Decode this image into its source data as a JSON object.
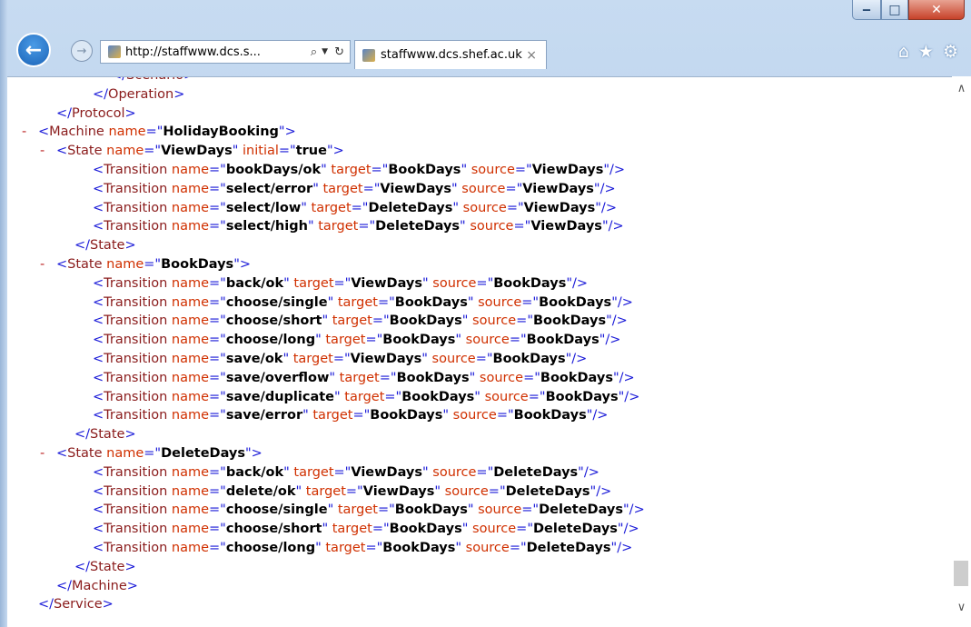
{
  "browser": {
    "address": "http://staffwww.dcs.s...",
    "tab_title": "staffwww.dcs.shef.ac.uk",
    "tab_close": "×",
    "icons": [
      "back-icon",
      "forward-icon",
      "search-icon",
      "refresh-icon",
      "close-icon",
      "home-icon",
      "star-icon",
      "gear-icon"
    ]
  },
  "xml_lines": [
    {
      "indent": 5,
      "minus": false,
      "parts": [
        [
          "blue",
          "</"
        ],
        [
          "tag",
          "Scenario"
        ],
        [
          "blue",
          ">"
        ]
      ]
    },
    {
      "indent": 4,
      "minus": false,
      "parts": [
        [
          "blue",
          "</"
        ],
        [
          "tag",
          "Operation"
        ],
        [
          "blue",
          ">"
        ]
      ]
    },
    {
      "indent": 2,
      "minus": false,
      "parts": [
        [
          "blue",
          "</"
        ],
        [
          "tag",
          "Protocol"
        ],
        [
          "blue",
          ">"
        ]
      ]
    },
    {
      "indent": 1,
      "minus": true,
      "parts": [
        [
          "blue",
          "<"
        ],
        [
          "tag",
          "Machine"
        ],
        [
          "attr",
          " name"
        ],
        [
          "blue",
          "=\""
        ],
        [
          "val",
          "HolidayBooking"
        ],
        [
          "blue",
          "\">"
        ]
      ]
    },
    {
      "indent": 2,
      "minus": true,
      "parts": [
        [
          "blue",
          "<"
        ],
        [
          "tag",
          "State"
        ],
        [
          "attr",
          " name"
        ],
        [
          "blue",
          "=\""
        ],
        [
          "val",
          "ViewDays"
        ],
        [
          "blue",
          "\""
        ],
        [
          "attr",
          " initial"
        ],
        [
          "blue",
          "=\""
        ],
        [
          "val",
          "true"
        ],
        [
          "blue",
          "\">"
        ]
      ]
    },
    {
      "indent": 4,
      "minus": false,
      "parts": [
        [
          "blue",
          "<"
        ],
        [
          "tag",
          "Transition"
        ],
        [
          "attr",
          " name"
        ],
        [
          "blue",
          "=\""
        ],
        [
          "val",
          "bookDays/ok"
        ],
        [
          "blue",
          "\""
        ],
        [
          "attr",
          " target"
        ],
        [
          "blue",
          "=\""
        ],
        [
          "val",
          "BookDays"
        ],
        [
          "blue",
          "\""
        ],
        [
          "attr",
          " source"
        ],
        [
          "blue",
          "=\""
        ],
        [
          "val",
          "ViewDays"
        ],
        [
          "blue",
          "\"/>"
        ]
      ]
    },
    {
      "indent": 4,
      "minus": false,
      "parts": [
        [
          "blue",
          "<"
        ],
        [
          "tag",
          "Transition"
        ],
        [
          "attr",
          " name"
        ],
        [
          "blue",
          "=\""
        ],
        [
          "val",
          "select/error"
        ],
        [
          "blue",
          "\""
        ],
        [
          "attr",
          " target"
        ],
        [
          "blue",
          "=\""
        ],
        [
          "val",
          "ViewDays"
        ],
        [
          "blue",
          "\""
        ],
        [
          "attr",
          " source"
        ],
        [
          "blue",
          "=\""
        ],
        [
          "val",
          "ViewDays"
        ],
        [
          "blue",
          "\"/>"
        ]
      ]
    },
    {
      "indent": 4,
      "minus": false,
      "parts": [
        [
          "blue",
          "<"
        ],
        [
          "tag",
          "Transition"
        ],
        [
          "attr",
          " name"
        ],
        [
          "blue",
          "=\""
        ],
        [
          "val",
          "select/low"
        ],
        [
          "blue",
          "\""
        ],
        [
          "attr",
          " target"
        ],
        [
          "blue",
          "=\""
        ],
        [
          "val",
          "DeleteDays"
        ],
        [
          "blue",
          "\""
        ],
        [
          "attr",
          " source"
        ],
        [
          "blue",
          "=\""
        ],
        [
          "val",
          "ViewDays"
        ],
        [
          "blue",
          "\"/>"
        ]
      ]
    },
    {
      "indent": 4,
      "minus": false,
      "parts": [
        [
          "blue",
          "<"
        ],
        [
          "tag",
          "Transition"
        ],
        [
          "attr",
          " name"
        ],
        [
          "blue",
          "=\""
        ],
        [
          "val",
          "select/high"
        ],
        [
          "blue",
          "\""
        ],
        [
          "attr",
          " target"
        ],
        [
          "blue",
          "=\""
        ],
        [
          "val",
          "DeleteDays"
        ],
        [
          "blue",
          "\""
        ],
        [
          "attr",
          " source"
        ],
        [
          "blue",
          "=\""
        ],
        [
          "val",
          "ViewDays"
        ],
        [
          "blue",
          "\"/>"
        ]
      ]
    },
    {
      "indent": 3,
      "minus": false,
      "parts": [
        [
          "blue",
          "</"
        ],
        [
          "tag",
          "State"
        ],
        [
          "blue",
          ">"
        ]
      ]
    },
    {
      "indent": 2,
      "minus": true,
      "parts": [
        [
          "blue",
          "<"
        ],
        [
          "tag",
          "State"
        ],
        [
          "attr",
          " name"
        ],
        [
          "blue",
          "=\""
        ],
        [
          "val",
          "BookDays"
        ],
        [
          "blue",
          "\">"
        ]
      ]
    },
    {
      "indent": 4,
      "minus": false,
      "parts": [
        [
          "blue",
          "<"
        ],
        [
          "tag",
          "Transition"
        ],
        [
          "attr",
          " name"
        ],
        [
          "blue",
          "=\""
        ],
        [
          "val",
          "back/ok"
        ],
        [
          "blue",
          "\""
        ],
        [
          "attr",
          " target"
        ],
        [
          "blue",
          "=\""
        ],
        [
          "val",
          "ViewDays"
        ],
        [
          "blue",
          "\""
        ],
        [
          "attr",
          " source"
        ],
        [
          "blue",
          "=\""
        ],
        [
          "val",
          "BookDays"
        ],
        [
          "blue",
          "\"/>"
        ]
      ]
    },
    {
      "indent": 4,
      "minus": false,
      "parts": [
        [
          "blue",
          "<"
        ],
        [
          "tag",
          "Transition"
        ],
        [
          "attr",
          " name"
        ],
        [
          "blue",
          "=\""
        ],
        [
          "val",
          "choose/single"
        ],
        [
          "blue",
          "\""
        ],
        [
          "attr",
          " target"
        ],
        [
          "blue",
          "=\""
        ],
        [
          "val",
          "BookDays"
        ],
        [
          "blue",
          "\""
        ],
        [
          "attr",
          " source"
        ],
        [
          "blue",
          "=\""
        ],
        [
          "val",
          "BookDays"
        ],
        [
          "blue",
          "\"/>"
        ]
      ]
    },
    {
      "indent": 4,
      "minus": false,
      "parts": [
        [
          "blue",
          "<"
        ],
        [
          "tag",
          "Transition"
        ],
        [
          "attr",
          " name"
        ],
        [
          "blue",
          "=\""
        ],
        [
          "val",
          "choose/short"
        ],
        [
          "blue",
          "\""
        ],
        [
          "attr",
          " target"
        ],
        [
          "blue",
          "=\""
        ],
        [
          "val",
          "BookDays"
        ],
        [
          "blue",
          "\""
        ],
        [
          "attr",
          " source"
        ],
        [
          "blue",
          "=\""
        ],
        [
          "val",
          "BookDays"
        ],
        [
          "blue",
          "\"/>"
        ]
      ]
    },
    {
      "indent": 4,
      "minus": false,
      "parts": [
        [
          "blue",
          "<"
        ],
        [
          "tag",
          "Transition"
        ],
        [
          "attr",
          " name"
        ],
        [
          "blue",
          "=\""
        ],
        [
          "val",
          "choose/long"
        ],
        [
          "blue",
          "\""
        ],
        [
          "attr",
          " target"
        ],
        [
          "blue",
          "=\""
        ],
        [
          "val",
          "BookDays"
        ],
        [
          "blue",
          "\""
        ],
        [
          "attr",
          " source"
        ],
        [
          "blue",
          "=\""
        ],
        [
          "val",
          "BookDays"
        ],
        [
          "blue",
          "\"/>"
        ]
      ]
    },
    {
      "indent": 4,
      "minus": false,
      "parts": [
        [
          "blue",
          "<"
        ],
        [
          "tag",
          "Transition"
        ],
        [
          "attr",
          " name"
        ],
        [
          "blue",
          "=\""
        ],
        [
          "val",
          "save/ok"
        ],
        [
          "blue",
          "\""
        ],
        [
          "attr",
          " target"
        ],
        [
          "blue",
          "=\""
        ],
        [
          "val",
          "ViewDays"
        ],
        [
          "blue",
          "\""
        ],
        [
          "attr",
          " source"
        ],
        [
          "blue",
          "=\""
        ],
        [
          "val",
          "BookDays"
        ],
        [
          "blue",
          "\"/>"
        ]
      ]
    },
    {
      "indent": 4,
      "minus": false,
      "parts": [
        [
          "blue",
          "<"
        ],
        [
          "tag",
          "Transition"
        ],
        [
          "attr",
          " name"
        ],
        [
          "blue",
          "=\""
        ],
        [
          "val",
          "save/overflow"
        ],
        [
          "blue",
          "\""
        ],
        [
          "attr",
          " target"
        ],
        [
          "blue",
          "=\""
        ],
        [
          "val",
          "BookDays"
        ],
        [
          "blue",
          "\""
        ],
        [
          "attr",
          " source"
        ],
        [
          "blue",
          "=\""
        ],
        [
          "val",
          "BookDays"
        ],
        [
          "blue",
          "\"/>"
        ]
      ]
    },
    {
      "indent": 4,
      "minus": false,
      "parts": [
        [
          "blue",
          "<"
        ],
        [
          "tag",
          "Transition"
        ],
        [
          "attr",
          " name"
        ],
        [
          "blue",
          "=\""
        ],
        [
          "val",
          "save/duplicate"
        ],
        [
          "blue",
          "\""
        ],
        [
          "attr",
          " target"
        ],
        [
          "blue",
          "=\""
        ],
        [
          "val",
          "BookDays"
        ],
        [
          "blue",
          "\""
        ],
        [
          "attr",
          " source"
        ],
        [
          "blue",
          "=\""
        ],
        [
          "val",
          "BookDays"
        ],
        [
          "blue",
          "\"/>"
        ]
      ]
    },
    {
      "indent": 4,
      "minus": false,
      "parts": [
        [
          "blue",
          "<"
        ],
        [
          "tag",
          "Transition"
        ],
        [
          "attr",
          " name"
        ],
        [
          "blue",
          "=\""
        ],
        [
          "val",
          "save/error"
        ],
        [
          "blue",
          "\""
        ],
        [
          "attr",
          " target"
        ],
        [
          "blue",
          "=\""
        ],
        [
          "val",
          "BookDays"
        ],
        [
          "blue",
          "\""
        ],
        [
          "attr",
          " source"
        ],
        [
          "blue",
          "=\""
        ],
        [
          "val",
          "BookDays"
        ],
        [
          "blue",
          "\"/>"
        ]
      ]
    },
    {
      "indent": 3,
      "minus": false,
      "parts": [
        [
          "blue",
          "</"
        ],
        [
          "tag",
          "State"
        ],
        [
          "blue",
          ">"
        ]
      ]
    },
    {
      "indent": 2,
      "minus": true,
      "parts": [
        [
          "blue",
          "<"
        ],
        [
          "tag",
          "State"
        ],
        [
          "attr",
          " name"
        ],
        [
          "blue",
          "=\""
        ],
        [
          "val",
          "DeleteDays"
        ],
        [
          "blue",
          "\">"
        ]
      ]
    },
    {
      "indent": 4,
      "minus": false,
      "parts": [
        [
          "blue",
          "<"
        ],
        [
          "tag",
          "Transition"
        ],
        [
          "attr",
          " name"
        ],
        [
          "blue",
          "=\""
        ],
        [
          "val",
          "back/ok"
        ],
        [
          "blue",
          "\""
        ],
        [
          "attr",
          " target"
        ],
        [
          "blue",
          "=\""
        ],
        [
          "val",
          "ViewDays"
        ],
        [
          "blue",
          "\""
        ],
        [
          "attr",
          " source"
        ],
        [
          "blue",
          "=\""
        ],
        [
          "val",
          "DeleteDays"
        ],
        [
          "blue",
          "\"/>"
        ]
      ]
    },
    {
      "indent": 4,
      "minus": false,
      "parts": [
        [
          "blue",
          "<"
        ],
        [
          "tag",
          "Transition"
        ],
        [
          "attr",
          " name"
        ],
        [
          "blue",
          "=\""
        ],
        [
          "val",
          "delete/ok"
        ],
        [
          "blue",
          "\""
        ],
        [
          "attr",
          " target"
        ],
        [
          "blue",
          "=\""
        ],
        [
          "val",
          "ViewDays"
        ],
        [
          "blue",
          "\""
        ],
        [
          "attr",
          " source"
        ],
        [
          "blue",
          "=\""
        ],
        [
          "val",
          "DeleteDays"
        ],
        [
          "blue",
          "\"/>"
        ]
      ]
    },
    {
      "indent": 4,
      "minus": false,
      "parts": [
        [
          "blue",
          "<"
        ],
        [
          "tag",
          "Transition"
        ],
        [
          "attr",
          " name"
        ],
        [
          "blue",
          "=\""
        ],
        [
          "val",
          "choose/single"
        ],
        [
          "blue",
          "\""
        ],
        [
          "attr",
          " target"
        ],
        [
          "blue",
          "=\""
        ],
        [
          "val",
          "BookDays"
        ],
        [
          "blue",
          "\""
        ],
        [
          "attr",
          " source"
        ],
        [
          "blue",
          "=\""
        ],
        [
          "val",
          "DeleteDays"
        ],
        [
          "blue",
          "\"/>"
        ]
      ]
    },
    {
      "indent": 4,
      "minus": false,
      "parts": [
        [
          "blue",
          "<"
        ],
        [
          "tag",
          "Transition"
        ],
        [
          "attr",
          " name"
        ],
        [
          "blue",
          "=\""
        ],
        [
          "val",
          "choose/short"
        ],
        [
          "blue",
          "\""
        ],
        [
          "attr",
          " target"
        ],
        [
          "blue",
          "=\""
        ],
        [
          "val",
          "BookDays"
        ],
        [
          "blue",
          "\""
        ],
        [
          "attr",
          " source"
        ],
        [
          "blue",
          "=\""
        ],
        [
          "val",
          "DeleteDays"
        ],
        [
          "blue",
          "\"/>"
        ]
      ]
    },
    {
      "indent": 4,
      "minus": false,
      "parts": [
        [
          "blue",
          "<"
        ],
        [
          "tag",
          "Transition"
        ],
        [
          "attr",
          " name"
        ],
        [
          "blue",
          "=\""
        ],
        [
          "val",
          "choose/long"
        ],
        [
          "blue",
          "\""
        ],
        [
          "attr",
          " target"
        ],
        [
          "blue",
          "=\""
        ],
        [
          "val",
          "BookDays"
        ],
        [
          "blue",
          "\""
        ],
        [
          "attr",
          " source"
        ],
        [
          "blue",
          "=\""
        ],
        [
          "val",
          "DeleteDays"
        ],
        [
          "blue",
          "\"/>"
        ]
      ]
    },
    {
      "indent": 3,
      "minus": false,
      "parts": [
        [
          "blue",
          "</"
        ],
        [
          "tag",
          "State"
        ],
        [
          "blue",
          ">"
        ]
      ]
    },
    {
      "indent": 2,
      "minus": false,
      "parts": [
        [
          "blue",
          "</"
        ],
        [
          "tag",
          "Machine"
        ],
        [
          "blue",
          ">"
        ]
      ]
    },
    {
      "indent": 1,
      "minus": false,
      "parts": [
        [
          "blue",
          "</"
        ],
        [
          "tag",
          "Service"
        ],
        [
          "blue",
          ">"
        ]
      ]
    }
  ]
}
